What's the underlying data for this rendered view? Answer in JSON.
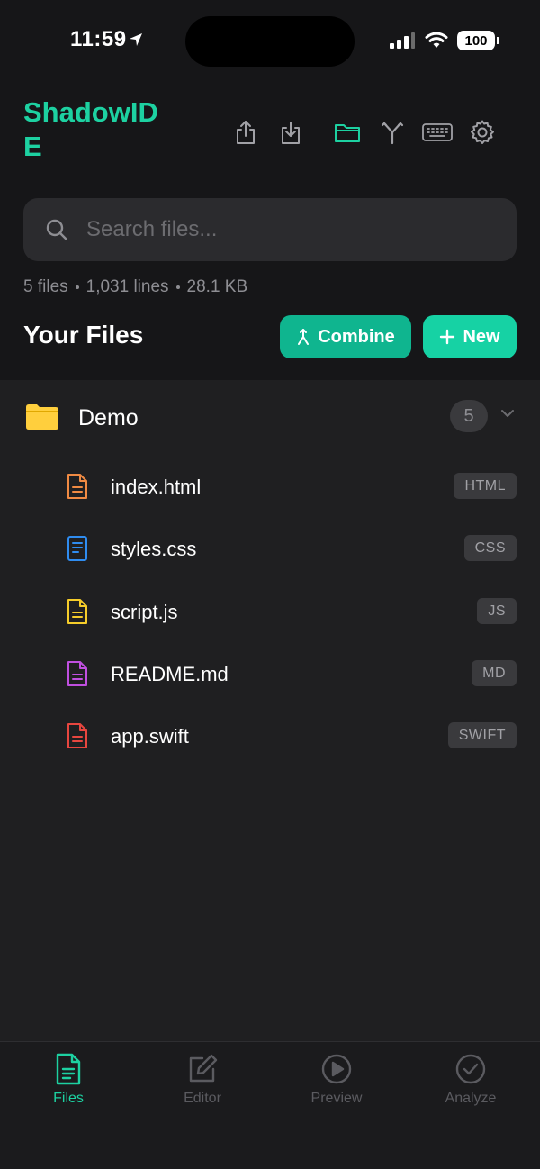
{
  "status_bar": {
    "time": "11:59",
    "battery": "100"
  },
  "app": {
    "title": "ShadowIDE"
  },
  "search": {
    "placeholder": "Search files..."
  },
  "stats": {
    "files": "5 files",
    "lines": "1,031 lines",
    "size": "28.1 KB"
  },
  "section": {
    "title": "Your Files",
    "combine_label": "Combine",
    "new_label": "New"
  },
  "folder": {
    "name": "Demo",
    "count": "5",
    "icon": "folder-icon",
    "color": "#ffcf3d"
  },
  "files": [
    {
      "name": "index.html",
      "ext": "HTML",
      "color": "#f08a43"
    },
    {
      "name": "styles.css",
      "ext": "CSS",
      "color": "#2f8cf0"
    },
    {
      "name": "script.js",
      "ext": "JS",
      "color": "#f5cc2a"
    },
    {
      "name": "README.md",
      "ext": "MD",
      "color": "#c04fe0"
    },
    {
      "name": "app.swift",
      "ext": "SWIFT",
      "color": "#e8463f"
    }
  ],
  "tabs": [
    {
      "label": "Files",
      "icon": "file-text-icon",
      "active": true
    },
    {
      "label": "Editor",
      "icon": "edit-icon",
      "active": false
    },
    {
      "label": "Preview",
      "icon": "play-circle-icon",
      "active": false
    },
    {
      "label": "Analyze",
      "icon": "check-circle-icon",
      "active": false
    }
  ],
  "colors": {
    "accent": "#1dd1a1",
    "background": "#161618",
    "panel": "#1f1f21"
  }
}
